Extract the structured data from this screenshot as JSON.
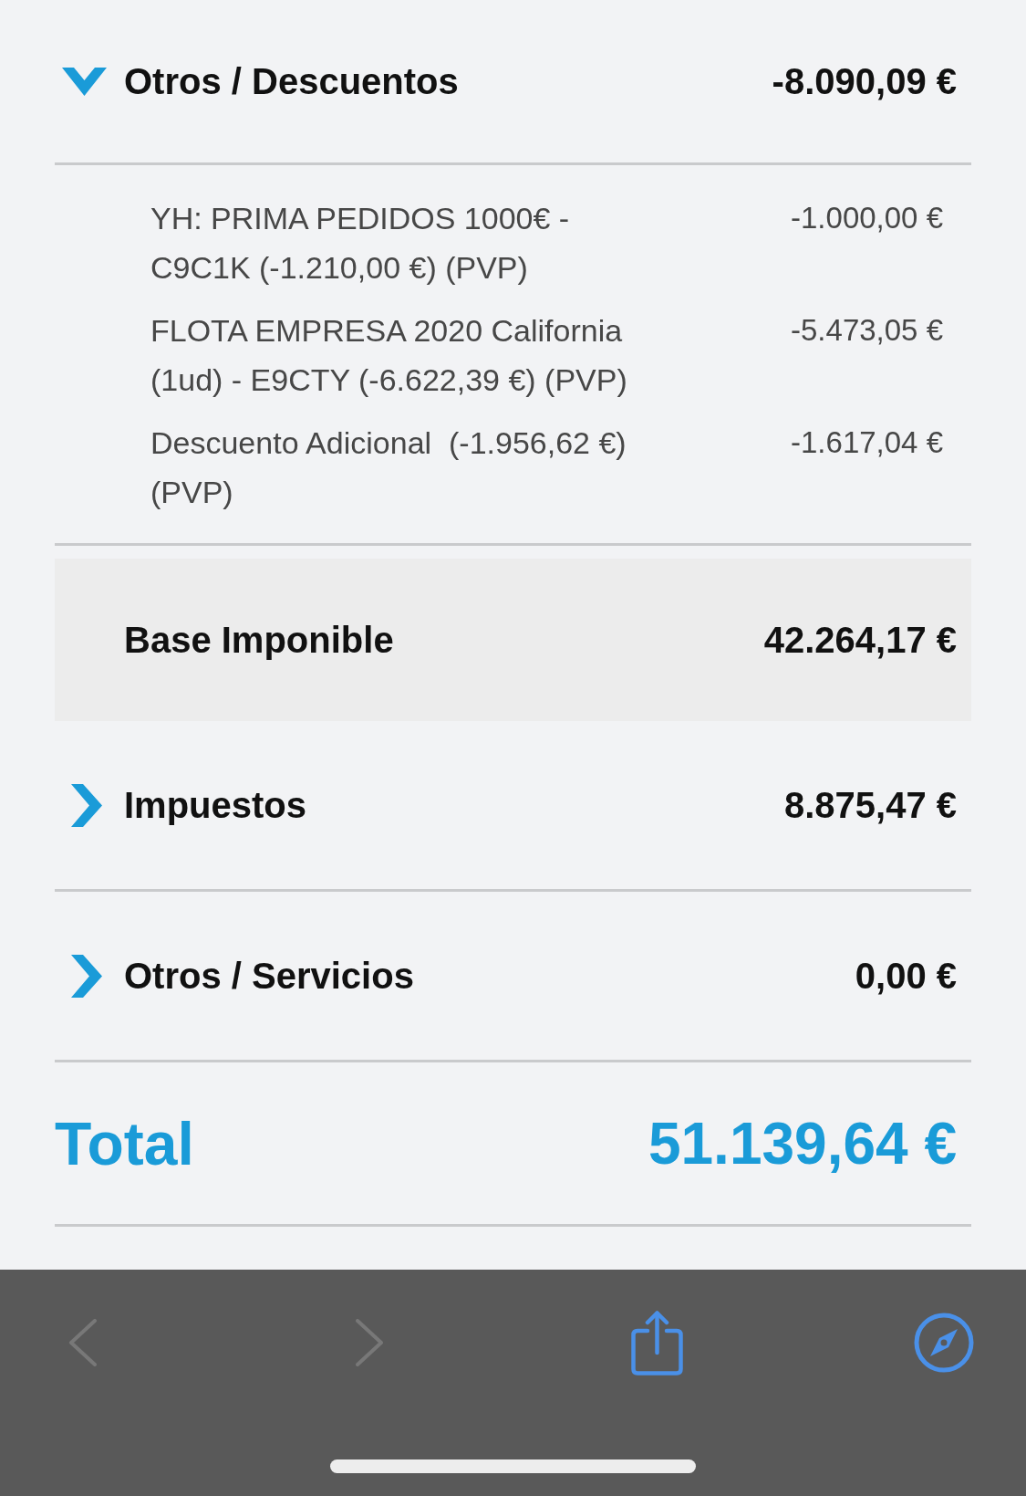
{
  "sections": [
    {
      "kind": "group",
      "title": "Otros / Descuentos",
      "amount": "-8.090,09 €",
      "expanded": true,
      "items": [
        {
          "description": "YH: PRIMA PEDIDOS 1000€ - C9C1K (-1.210,00 €) (PVP)",
          "amount": "-1.000,00 €"
        },
        {
          "description": "FLOTA EMPRESA 2020 California (1ud) - E9CTY (-6.622,39 €) (PVP)",
          "amount": "-5.473,05 €"
        },
        {
          "description": "Descuento Adicional  (-1.956,62 €) (PVP)",
          "amount": "-1.617,04 €"
        }
      ]
    },
    {
      "kind": "subtotal",
      "title": "Base Imponible",
      "amount": "42.264,17 €"
    },
    {
      "kind": "group",
      "title": "Impuestos",
      "amount": "8.875,47 €",
      "expanded": false
    },
    {
      "kind": "group",
      "title": "Otros / Servicios",
      "amount": "0,00 €",
      "expanded": false
    }
  ],
  "total": {
    "label": "Total",
    "amount": "51.139,64 €"
  },
  "toolbar": [
    {
      "kind": "back",
      "disabled": true
    },
    {
      "kind": "forward",
      "disabled": true
    },
    {
      "kind": "share",
      "disabled": false
    },
    {
      "kind": "compass",
      "disabled": false
    }
  ]
}
